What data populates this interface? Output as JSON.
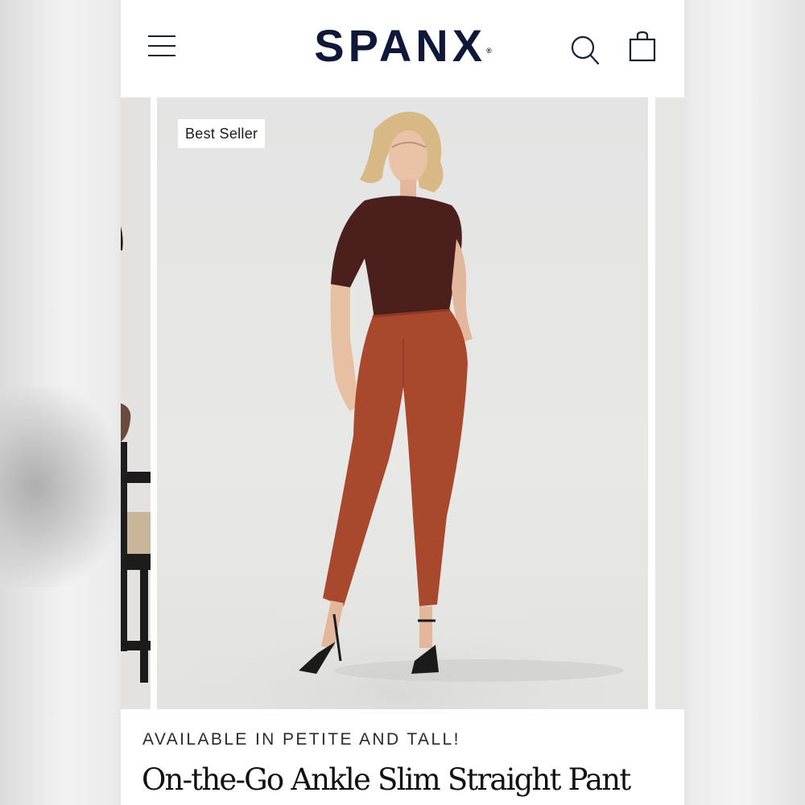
{
  "header": {
    "brand": "SPANX",
    "brand_mark": "®",
    "menu_icon": "hamburger-menu-icon",
    "search_icon": "search-icon",
    "bag_icon": "shopping-bag-icon"
  },
  "carousel": {
    "badge": "Best Seller",
    "main_image": "model in brown short-sleeve top and rust ankle pants with black strappy heels"
  },
  "product": {
    "tagline": "AVAILABLE IN PETITE AND TALL!",
    "title": "On-the-Go Ankle Slim Straight Pant"
  },
  "colors": {
    "brand_navy": "#10183a",
    "pant_rust": "#a8492e",
    "top_brown": "#4a1f1c"
  }
}
